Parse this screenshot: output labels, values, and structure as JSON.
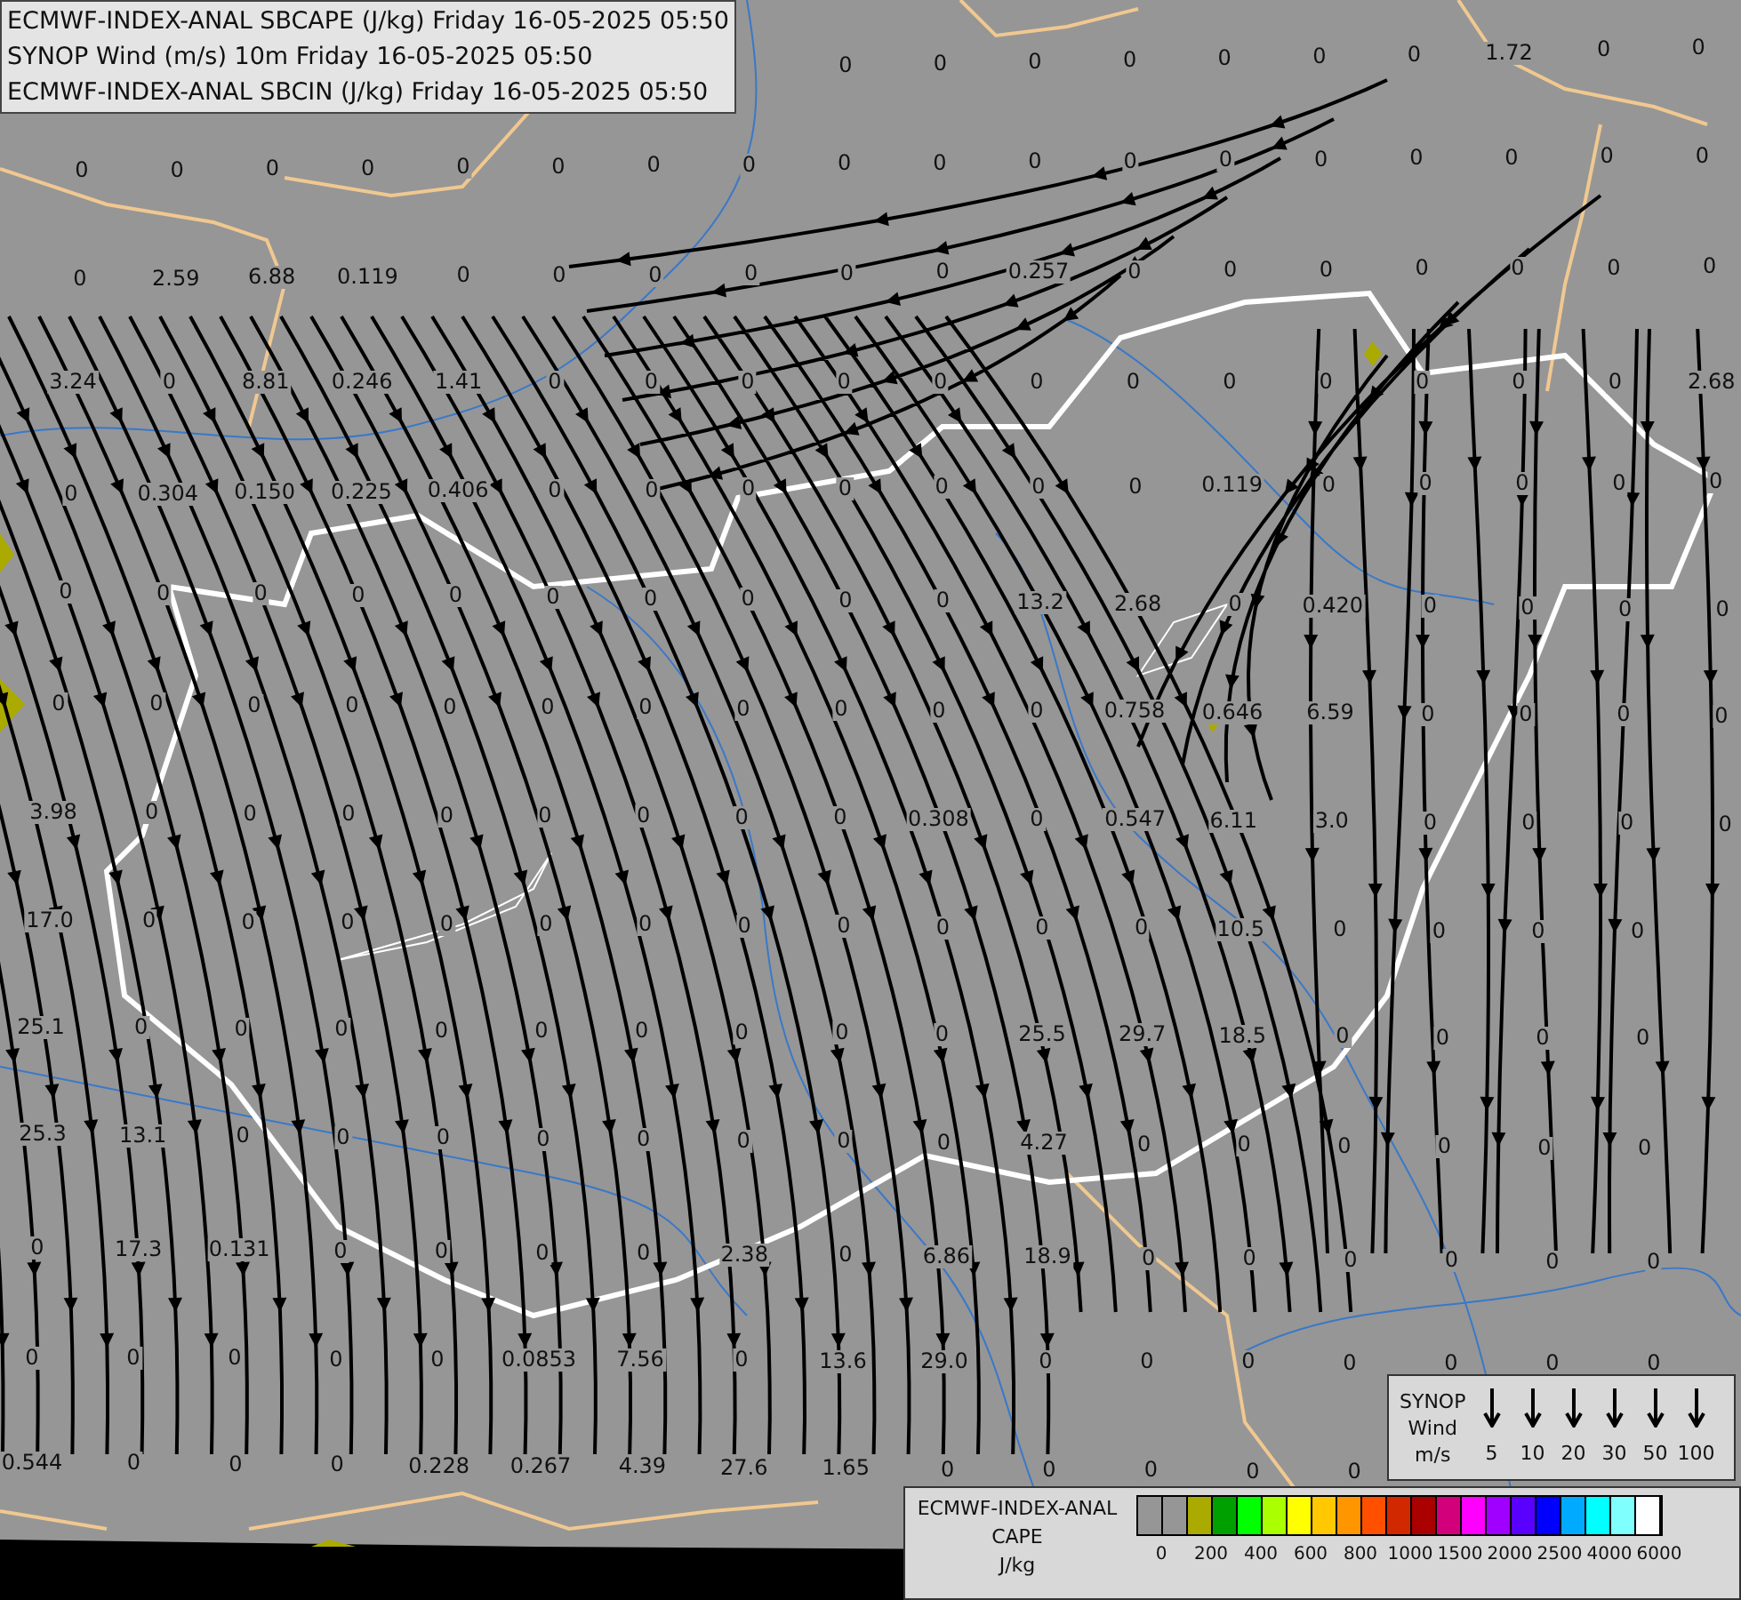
{
  "header": {
    "lines": [
      "ECMWF-INDEX-ANAL SBCAPE (J/kg) Friday 16-05-2025 05:50",
      "SYNOP Wind (m/s) 10m Friday 16-05-2025 05:50",
      "ECMWF-INDEX-ANAL SBCIN (J/kg) Friday 16-05-2025 05:50"
    ]
  },
  "map": {
    "value_labels": [
      [
        "0",
        "0",
        "0",
        "0",
        "0",
        "0",
        "0",
        "1.72",
        "0",
        "0"
      ],
      [
        "0",
        "0",
        "0",
        "0",
        "0",
        "0",
        "0",
        "0",
        "0",
        "0",
        "0",
        "0",
        "0",
        "0",
        "0",
        "0",
        "0",
        "0"
      ],
      [
        "0",
        "2.59",
        "6.88",
        "0.119",
        "0",
        "0",
        "0",
        "0",
        "0",
        "0",
        "0.257",
        "0",
        "0",
        "0",
        "0",
        "0",
        "0",
        "0"
      ],
      [
        "3.24",
        "0",
        "8.81",
        "0.246",
        "1.41",
        "0",
        "0",
        "0",
        "0",
        "0",
        "0",
        "0",
        "0",
        "0",
        "0",
        "0",
        "0",
        "2.68"
      ],
      [
        "0",
        "0.304",
        "0.150",
        "0.225",
        "0.406",
        "0",
        "0",
        "0",
        "0",
        "0",
        "0",
        "0",
        "0.119",
        "0",
        "0",
        "0",
        "0",
        "0"
      ],
      [
        "0",
        "0",
        "0",
        "0",
        "0",
        "0",
        "0",
        "0",
        "0",
        "0",
        "13.2",
        "2.68",
        "0",
        "0.420",
        "0",
        "0",
        "0",
        "0"
      ],
      [
        "0",
        "0",
        "0",
        "0",
        "0",
        "0",
        "0",
        "0",
        "0",
        "0",
        "0",
        "0.758",
        "0.646",
        "6.59",
        "0",
        "0",
        "0",
        "0"
      ],
      [
        "3.98",
        "0",
        "0",
        "0",
        "0",
        "0",
        "0",
        "0",
        "0",
        "0.308",
        "0",
        "0.547",
        "6.11",
        "3.0",
        "0",
        "0",
        "0",
        "0"
      ],
      [
        "17.0",
        "0",
        "0",
        "0",
        "0",
        "0",
        "0",
        "0",
        "0",
        "0",
        "0",
        "0",
        "10.5",
        "0",
        "0",
        "0",
        "0"
      ],
      [
        "25.1",
        "0",
        "0",
        "0",
        "0",
        "0",
        "0",
        "0",
        "0",
        "0",
        "25.5",
        "29.7",
        "18.5",
        "0",
        "0",
        "0",
        "0"
      ],
      [
        "25.3",
        "13.1",
        "0",
        "0",
        "0",
        "0",
        "0",
        "0",
        "0",
        "0",
        "4.27",
        "0",
        "0",
        "0",
        "0",
        "0",
        "0"
      ],
      [
        "0",
        "17.3",
        "0.131",
        "0",
        "0",
        "0",
        "0",
        "2.38",
        "0",
        "6.86",
        "18.9",
        "0",
        "0",
        "0",
        "0",
        "0",
        "0"
      ],
      [
        "0",
        "0",
        "0",
        "0",
        "0",
        "0.0853",
        "7.56",
        "0",
        "13.6",
        "29.0",
        "0",
        "0",
        "0",
        "0",
        "0",
        "0",
        "0"
      ],
      [
        "0.544",
        "0",
        "0",
        "0",
        "0.228",
        "0.267",
        "4.39",
        "27.6",
        "1.65",
        "0",
        "0",
        "0",
        "0",
        "0"
      ]
    ]
  },
  "wind_legend": {
    "title_lines": [
      "SYNOP",
      "Wind",
      "m/s"
    ],
    "speeds": [
      "5",
      "10",
      "20",
      "30",
      "50",
      "100"
    ]
  },
  "cape_legend": {
    "title_lines": [
      "ECMWF-INDEX-ANAL",
      "CAPE",
      "J/kg"
    ],
    "swatches": [
      {
        "color": "#969696"
      },
      {
        "color": "#969696"
      },
      {
        "color": "#aaaa00"
      },
      {
        "color": "#00a000"
      },
      {
        "color": "#00ff00"
      },
      {
        "color": "#aaff00"
      },
      {
        "color": "#ffff00"
      },
      {
        "color": "#ffc800"
      },
      {
        "color": "#ff9600"
      },
      {
        "color": "#ff5000"
      },
      {
        "color": "#d22800"
      },
      {
        "color": "#aa0000"
      },
      {
        "color": "#d2007a"
      },
      {
        "color": "#ff00ff"
      },
      {
        "color": "#a000ff"
      },
      {
        "color": "#5a00ff"
      },
      {
        "color": "#0000ff"
      },
      {
        "color": "#00aaff"
      },
      {
        "color": "#00ffff"
      },
      {
        "color": "#80ffff"
      },
      {
        "color": "#ffffff"
      }
    ],
    "ticks": [
      "0",
      "200",
      "400",
      "600",
      "800",
      "1000",
      "1500",
      "2000",
      "2500",
      "4000",
      "6000"
    ]
  }
}
